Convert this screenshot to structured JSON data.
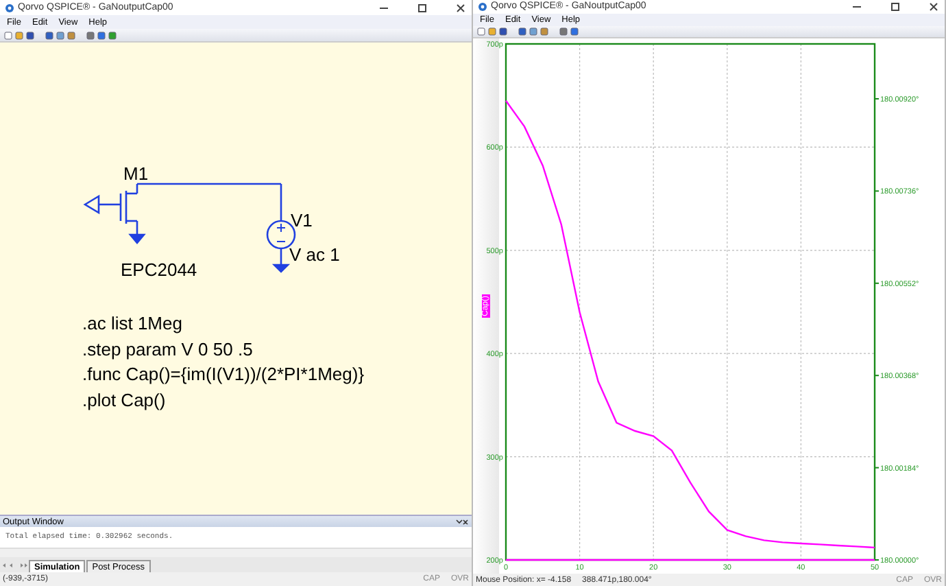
{
  "windows": [
    {
      "kind": "schematic",
      "title": "Qorvo QSPICE® - GaNoutputCap00",
      "menu": [
        "File",
        "Edit",
        "View",
        "Help"
      ],
      "schematic": {
        "components": [
          {
            "kind": "nmos",
            "ref": "M1",
            "value": "EPC2044"
          },
          {
            "kind": "vsource",
            "ref": "V1",
            "value": "V ac 1"
          }
        ],
        "directives": [
          ".ac list 1Meg",
          ".step param V 0 50 .5",
          ".func Cap()={im(I(V1))/(2*PI*1Meg)}",
          ".plot Cap()"
        ]
      },
      "output_window": {
        "title": "Output Window",
        "lines": [
          "Total elapsed time: 0.302962 seconds."
        ],
        "tabs": [
          {
            "label": "Simulation",
            "selected": true
          },
          {
            "label": "Post Process",
            "selected": false
          }
        ]
      },
      "status_bar": {
        "position": "(-939,-3715)",
        "indicators": [
          "CAP",
          "OVR"
        ]
      }
    },
    {
      "kind": "plot",
      "title": "Qorvo QSPICE® - GaNoutputCap00",
      "menu": [
        "File",
        "Edit",
        "View",
        "Help"
      ],
      "plot": {
        "chart_data": {
          "type": "line",
          "grid": true,
          "x": [
            0,
            2.5,
            5,
            7.5,
            10,
            12.5,
            15,
            17.5,
            20,
            22.5,
            25,
            27.5,
            30,
            32.5,
            35,
            37.5,
            40,
            42.5,
            45,
            47.5,
            50
          ],
          "series": [
            {
              "name": "Cap()",
              "color": "#ff00ff",
              "values": [
                645,
                620,
                582,
                525,
                440,
                373,
                333,
                325,
                320,
                306,
                275,
                247,
                229,
                223,
                219,
                217,
                216,
                215,
                214,
                213,
                212
              ]
            },
            {
              "color": "#ff00ff",
              "values": [
                200,
                200,
                200,
                200,
                200,
                200,
                200,
                200,
                200,
                200,
                200,
                200,
                200,
                200,
                200,
                200,
                200,
                200,
                200,
                200,
                200
              ]
            }
          ],
          "xlim": [
            0,
            50
          ],
          "ylim": [
            200,
            700
          ],
          "xticks": [
            0,
            10,
            20,
            30,
            40,
            50
          ],
          "yticks": [
            {
              "value": 200,
              "label": "200p"
            },
            {
              "value": 300,
              "label": "300p"
            },
            {
              "value": 400,
              "label": "400p"
            },
            {
              "value": 500,
              "label": "500p"
            },
            {
              "value": 600,
              "label": "600p"
            },
            {
              "value": 700,
              "label": "700p"
            }
          ]
        },
        "right_axis": {
          "ticks": [
            "180.00920°",
            "180.00736°",
            "180.00552°",
            "180.00368°",
            "180.00184°",
            "180.00000°"
          ]
        }
      },
      "status_bar": {
        "position": "Mouse Position: x= -4.158",
        "value": "388.471p,180.004°",
        "indicators": [
          "CAP",
          "OVR"
        ]
      }
    }
  ]
}
